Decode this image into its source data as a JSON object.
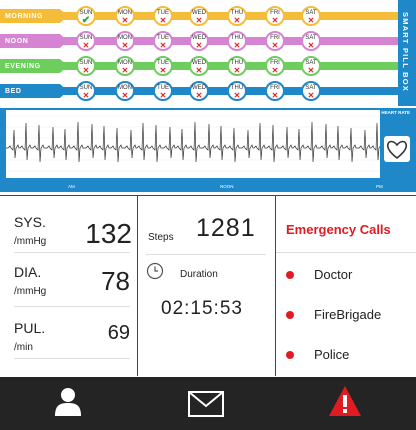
{
  "pillbox": {
    "title": "SMART PILL BOX",
    "rows": [
      {
        "label": "MORNING",
        "color": "#f3bd3a",
        "marks": [
          "check",
          "x",
          "x",
          "x",
          "x",
          "x",
          "x"
        ]
      },
      {
        "label": "NOON",
        "color": "#d684d2",
        "marks": [
          "x",
          "x",
          "x",
          "x",
          "x",
          "x",
          "x"
        ]
      },
      {
        "label": "EVENING",
        "color": "#6dcd5d",
        "marks": [
          "x",
          "x",
          "x",
          "x",
          "x",
          "x",
          "x"
        ]
      },
      {
        "label": "BED",
        "color": "#1e88c9",
        "marks": [
          "x",
          "x",
          "x",
          "x",
          "x",
          "x",
          "x"
        ]
      }
    ],
    "days": [
      "SUN",
      "MON",
      "TUE",
      "WED",
      "THU",
      "FRI",
      "SAT"
    ]
  },
  "heart_rate": {
    "label": "HEART RATE",
    "x_ticks": [
      "AM",
      "NOON",
      "PM"
    ]
  },
  "vitals": {
    "sys": {
      "name": "SYS.",
      "unit": "/mmHg",
      "value": "132"
    },
    "dia": {
      "name": "DIA.",
      "unit": "/mmHg",
      "value": "78"
    },
    "pul": {
      "name": "PUL.",
      "unit": "/min",
      "value": "69"
    }
  },
  "activity": {
    "steps_label": "Steps",
    "steps_value": "1281",
    "duration_label": "Duration",
    "duration_value": "02:15:53"
  },
  "emergency": {
    "title": "Emergency Calls",
    "contacts": [
      "Doctor",
      "FireBrigade",
      "Police"
    ],
    "accent": "#e11b22"
  },
  "footer": {
    "icons": [
      "user-icon",
      "mail-icon",
      "alert-icon"
    ]
  }
}
